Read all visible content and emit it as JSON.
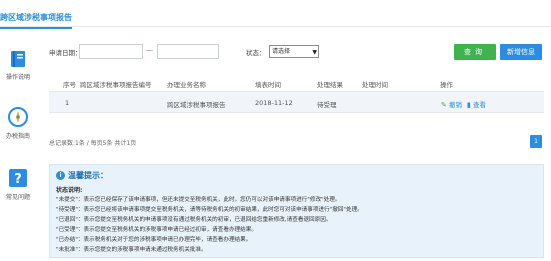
{
  "header": {
    "title": "跨区域涉税事项报告"
  },
  "sidebar": {
    "items": [
      {
        "label": "操作说明",
        "icon": "book-icon"
      },
      {
        "label": "办税指南",
        "icon": "compass-icon"
      },
      {
        "label": "常见问题",
        "icon": "question-icon"
      }
    ]
  },
  "filters": {
    "date_label": "申请日期：",
    "date_separator": "—",
    "date_from_value": "",
    "date_to_value": "",
    "status_label": "状态：",
    "status_selected": "请选择",
    "query_button": "查询",
    "add_button": "新增信息"
  },
  "table": {
    "columns": [
      "序号",
      "跨区域涉税事项报告编号",
      "办理业务名称",
      "填表时间",
      "处理结果",
      "处理时间",
      "操作"
    ],
    "rows": [
      {
        "index": "1",
        "report_no": "",
        "business": "跨区域涉税事项报告",
        "fill_time": "2018-11-12",
        "result": "待受理",
        "handle_time": "",
        "op_revoke": "撤销",
        "op_view": "查看"
      }
    ]
  },
  "pagination": {
    "summary": "总记录数:1条 / 每页5条 共计1页",
    "current_page": "1"
  },
  "tips": {
    "title": "温馨提示：",
    "subtitle": "状态说明:",
    "lines": [
      "\"未提交\"：表示您已经保存了该申请事项，但还未提交至税务机关，此时，您仍可以对该申请事项进行\"修改\"处理。",
      "\"待受理\"：表示您已经将该申请事项提交至税务机关，请等待税务机关的初审结果，此时您可对该申请事项进行\"撤回\"处理。",
      "\"已退回\"：表示您提交至税务机关的申请事项没有通过税务机关的初审，已退回给您重新修改,请查看退回原因。",
      "\"已受理\"：表示您提交至税务机关的涉税事项申请已经过初审，请查看办理结果。",
      "\"已办结\"：表示税务机关对于您的涉税事项申请已办理完毕，请查看办理结果。",
      "\"未批准\"：表示您提交的涉税事项申请未通过税务机关批准。"
    ]
  },
  "colors": {
    "accent": "#2b8ed6",
    "query_green": "#3fb34f",
    "add_blue": "#2d8ce0",
    "tips_bg": "#e8f2fb"
  }
}
